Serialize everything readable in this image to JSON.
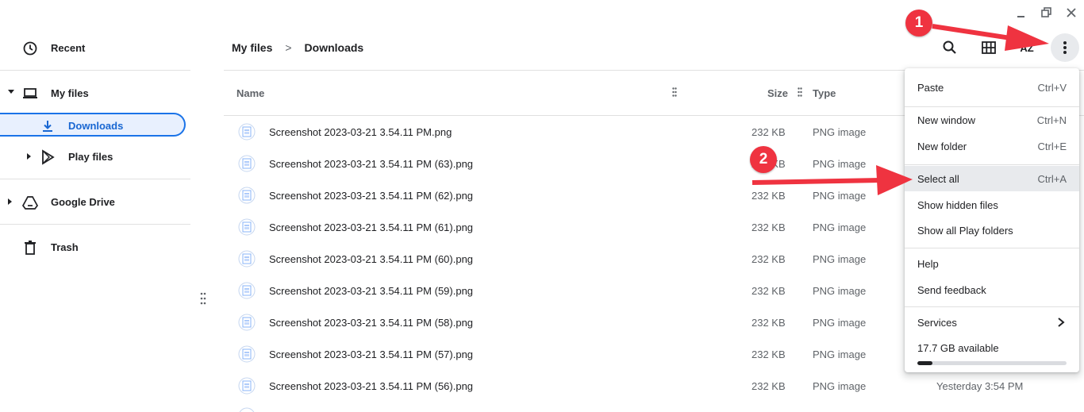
{
  "sidebar": {
    "recent": "Recent",
    "my_files": "My files",
    "downloads": "Downloads",
    "play_files": "Play files",
    "google_drive": "Google Drive",
    "trash": "Trash"
  },
  "breadcrumb": {
    "root": "My files",
    "separator": ">",
    "current": "Downloads"
  },
  "toolbar": {
    "search_icon": "search-icon",
    "grid_icon": "grid-view-icon",
    "sort_label": "AZ",
    "more_icon": "more-vertical-icon"
  },
  "columns": {
    "name": "Name",
    "size": "Size",
    "type": "Type"
  },
  "files": [
    {
      "name": "Screenshot 2023-03-21 3.54.11 PM.png",
      "size": "232 KB",
      "type": "PNG image",
      "date": ""
    },
    {
      "name": "Screenshot 2023-03-21 3.54.11 PM (63).png",
      "size": "232 KB",
      "type": "PNG image",
      "date": ""
    },
    {
      "name": "Screenshot 2023-03-21 3.54.11 PM (62).png",
      "size": "232 KB",
      "type": "PNG image",
      "date": ""
    },
    {
      "name": "Screenshot 2023-03-21 3.54.11 PM (61).png",
      "size": "232 KB",
      "type": "PNG image",
      "date": ""
    },
    {
      "name": "Screenshot 2023-03-21 3.54.11 PM (60).png",
      "size": "232 KB",
      "type": "PNG image",
      "date": ""
    },
    {
      "name": "Screenshot 2023-03-21 3.54.11 PM (59).png",
      "size": "232 KB",
      "type": "PNG image",
      "date": ""
    },
    {
      "name": "Screenshot 2023-03-21 3.54.11 PM (58).png",
      "size": "232 KB",
      "type": "PNG image",
      "date": ""
    },
    {
      "name": "Screenshot 2023-03-21 3.54.11 PM (57).png",
      "size": "232 KB",
      "type": "PNG image",
      "date": ""
    },
    {
      "name": "Screenshot 2023-03-21 3.54.11 PM (56).png",
      "size": "232 KB",
      "type": "PNG image",
      "date": "Yesterday 3:54 PM"
    }
  ],
  "menu": {
    "paste": {
      "label": "Paste",
      "shortcut": "Ctrl+V"
    },
    "new_window": {
      "label": "New window",
      "shortcut": "Ctrl+N"
    },
    "new_folder": {
      "label": "New folder",
      "shortcut": "Ctrl+E"
    },
    "select_all": {
      "label": "Select all",
      "shortcut": "Ctrl+A"
    },
    "show_hidden": {
      "label": "Show hidden files"
    },
    "show_play": {
      "label": "Show all Play folders"
    },
    "help": {
      "label": "Help"
    },
    "send_feedback": {
      "label": "Send feedback"
    },
    "services": {
      "label": "Services"
    },
    "storage": {
      "label": "17.7 GB available",
      "used_fraction": 0.1
    }
  },
  "annotations": {
    "badge1": "1",
    "badge2": "2",
    "color": "#ef3340"
  },
  "colors": {
    "accent": "#1a73e8",
    "selected_bg": "#e8f0fe",
    "annotation": "#ef3340"
  }
}
